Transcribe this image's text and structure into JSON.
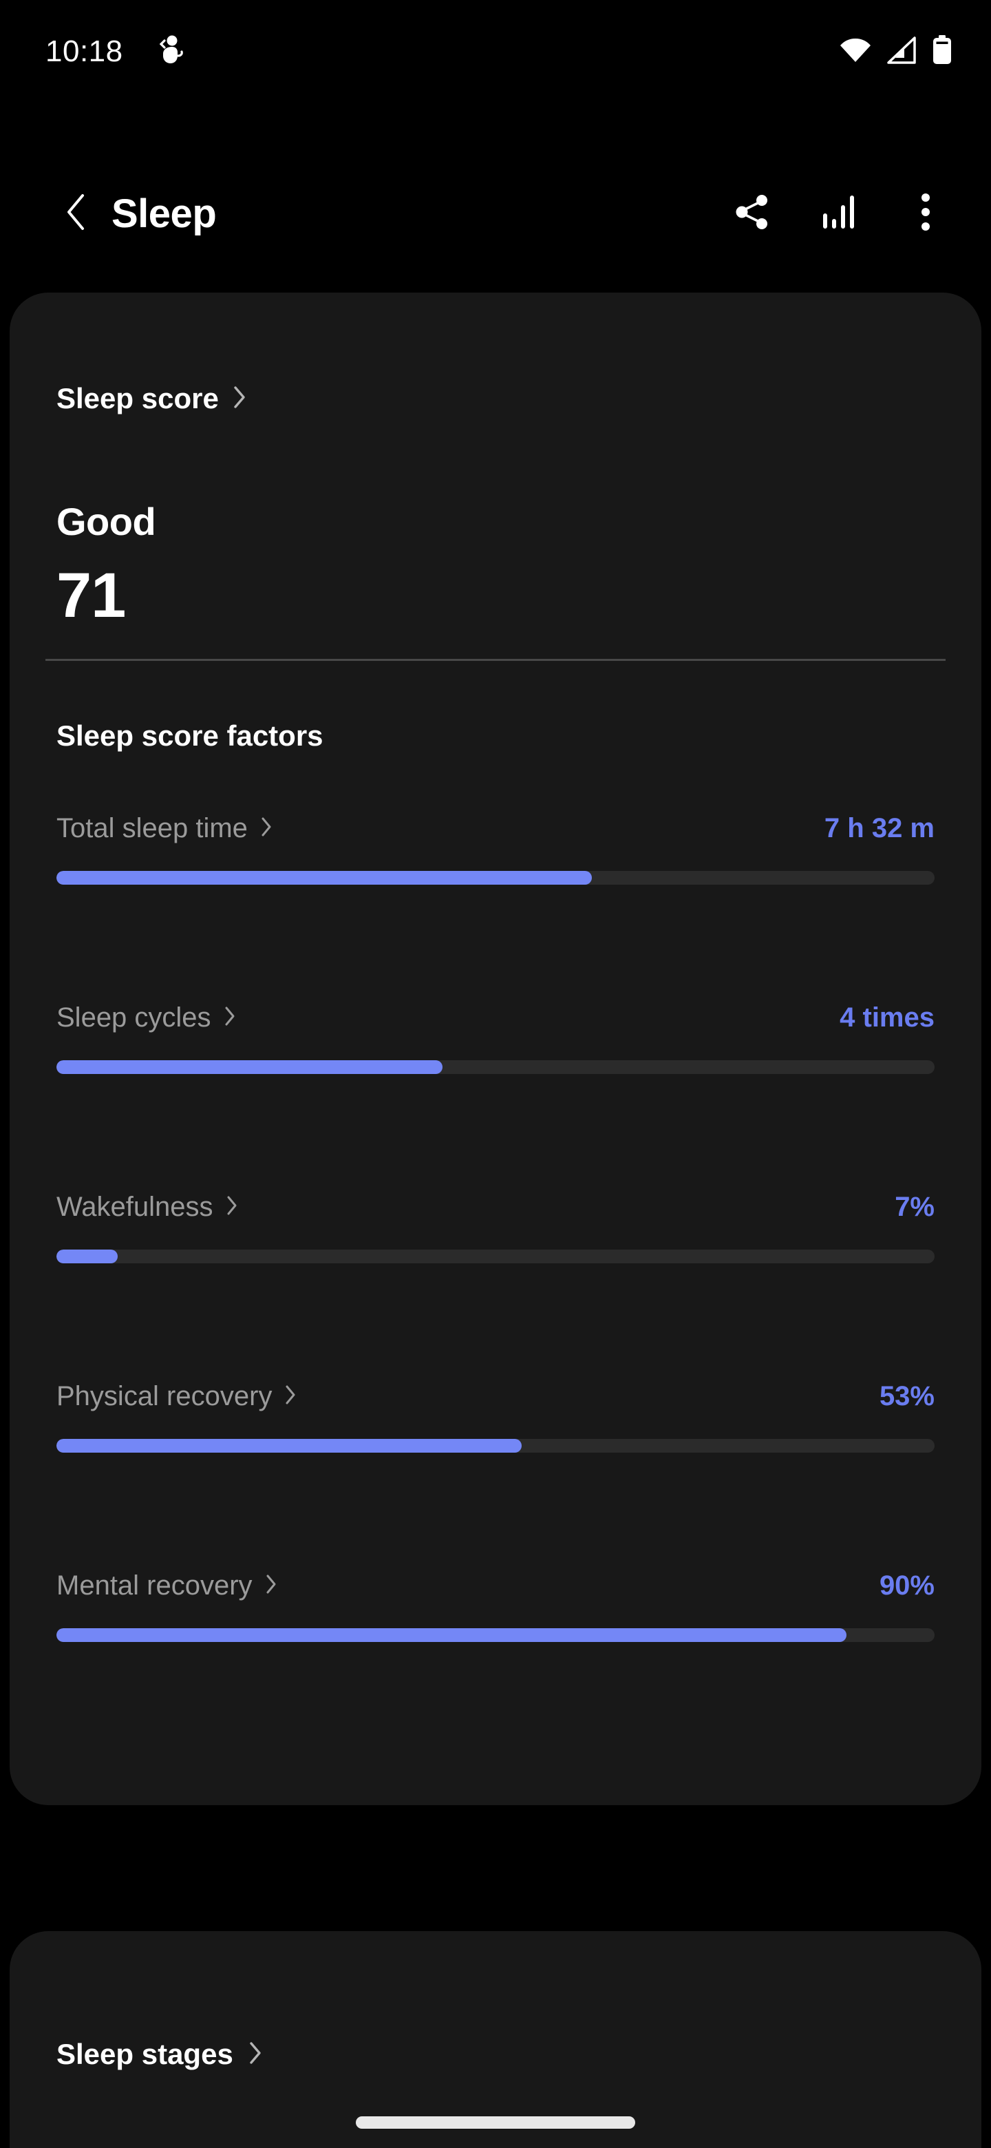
{
  "status_bar": {
    "clock": "10:18",
    "icons": [
      "health-figure-icon",
      "wifi-icon",
      "cellular-signal-icon",
      "battery-icon"
    ]
  },
  "app_bar": {
    "back_label": "back-chevron-icon",
    "title": "Sleep",
    "actions": [
      {
        "name": "share-icon",
        "label": "Share"
      },
      {
        "name": "bar-chart-icon",
        "label": "Trends"
      },
      {
        "name": "more-options-icon",
        "label": "More options"
      }
    ]
  },
  "sleep_score_card": {
    "header_label": "Sleep score",
    "rating": "Good",
    "score": "71",
    "factors_title": "Sleep score factors",
    "factors": [
      {
        "name": "Total sleep time",
        "value": "7 h 32 m",
        "percent": 61
      },
      {
        "name": "Sleep cycles",
        "value": "4 times",
        "percent": 44
      },
      {
        "name": "Wakefulness",
        "value": "7%",
        "percent": 7
      },
      {
        "name": "Physical recovery",
        "value": "53%",
        "percent": 53
      },
      {
        "name": "Mental recovery",
        "value": "90%",
        "percent": 90
      }
    ]
  },
  "sleep_stages_card": {
    "header_label": "Sleep stages"
  },
  "colors": {
    "accent_blue": "#6A7DF0",
    "bar_fill": "#7487F6",
    "bar_track": "#2b2b2b",
    "card_bg": "#181818",
    "page_bg": "#000000",
    "label_gray": "#9b9b9b",
    "divider": "#484848"
  }
}
